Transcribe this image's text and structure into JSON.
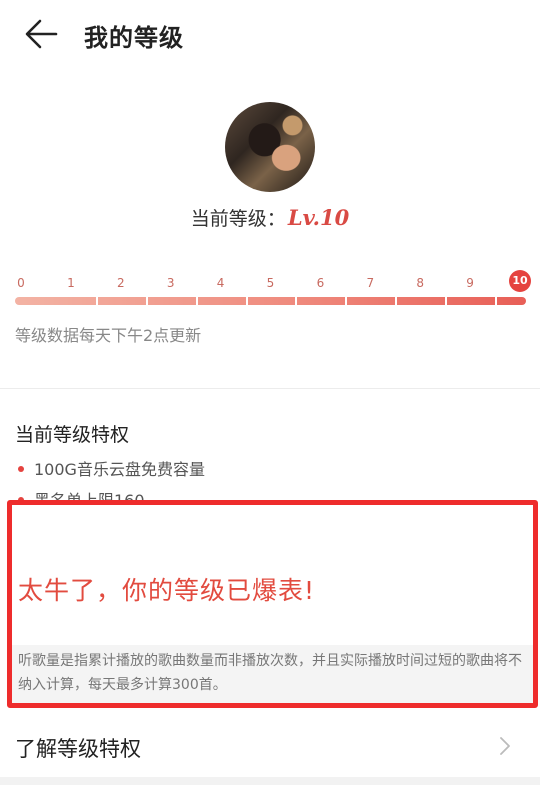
{
  "header": {
    "title": "我的等级",
    "back_icon": "arrow-left-icon"
  },
  "profile": {
    "level_label": "当前等级：",
    "level_value": "Lv.10",
    "accent_color": "#d94a44"
  },
  "progress": {
    "ticks": [
      "0",
      "1",
      "2",
      "3",
      "4",
      "5",
      "6",
      "7",
      "8",
      "9",
      "10"
    ],
    "current_level": 10,
    "max_level": 10,
    "update_note": "等级数据每天下午2点更新"
  },
  "privileges": {
    "title": "当前等级特权",
    "items": [
      "100G音乐云盘免费容量",
      "黑名单上限160"
    ]
  },
  "overlay": {
    "boast_text": "太牛了，你的等级已爆表!",
    "note": "听歌量是指累计播放的歌曲数量而非播放次数，并且实际播放时间过短的歌曲将不纳入计算，每天最多计算300首。",
    "border_color": "#ee2c2c"
  },
  "footer": {
    "learn_label": "了解等级特权",
    "chevron_icon": "chevron-right-icon"
  }
}
